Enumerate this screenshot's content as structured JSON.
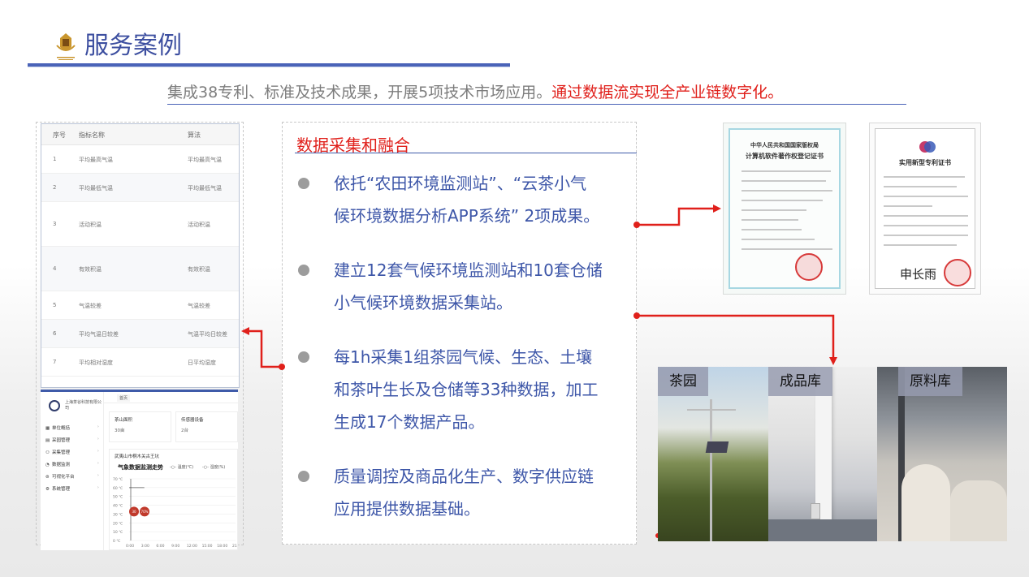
{
  "header": {
    "title": "服务案例",
    "subtitle_plain": "集成38专利、标准及技术成果，开展5项技术市场应用。",
    "subtitle_highlight": "通过数据流实现全产业链数字化。"
  },
  "table": {
    "headers": [
      "序号",
      "指标名称",
      "算法"
    ],
    "rows": [
      {
        "no": "1",
        "name": "平均最高气温",
        "algo": "平均最高气温"
      },
      {
        "no": "2",
        "name": "平均最低气温",
        "algo": "平均最低气温"
      },
      {
        "no": "3",
        "name": "活动积温",
        "algo": "活动积温"
      },
      {
        "no": "4",
        "name": "有效积温",
        "algo": "有效积温"
      },
      {
        "no": "5",
        "name": "气温较差",
        "algo": "气温较差"
      },
      {
        "no": "6",
        "name": "平均气温日较差",
        "algo": "气温平均日较差"
      },
      {
        "no": "7",
        "name": "平均相对湿度",
        "algo": "日平均湿度"
      }
    ]
  },
  "dashboard": {
    "company": "上海茶谷科技有限公司",
    "tab": "首页",
    "menu": [
      "单位概括",
      "采园管理",
      "采集管理",
      "数据监测",
      "可视化平台",
      "系统管理"
    ],
    "cards": [
      {
        "label": "茶山面积",
        "value": "30亩"
      },
      {
        "label": "传感器设备",
        "value": "2台"
      }
    ],
    "chart_name": "武夷山市桐木关古王坑",
    "chart_title": "气象数据监测走势",
    "legend": [
      "温度(℃)",
      "湿度(%)"
    ],
    "markers": [
      "30",
      "70%"
    ],
    "y_ticks": [
      "70 ℃",
      "60 ℃",
      "50 ℃",
      "40 ℃",
      "30 ℃",
      "20 ℃",
      "10 ℃",
      "0 ℃"
    ],
    "x_ticks": [
      "0:00",
      "3:00",
      "6:00",
      "9:00",
      "12:00",
      "15:00",
      "18:00",
      "21"
    ]
  },
  "center": {
    "title": "数据采集和融合",
    "bullets": [
      {
        "lines": [
          "依托“农田环境监测站”、“云茶小气",
          "候环境数据分析APP系统” 2项成果。"
        ]
      },
      {
        "lines": [
          "建立12套气候环境监测站和10套仓储",
          "小气候环境数据采集站。"
        ]
      },
      {
        "lines": [
          "每1h采集1组茶园气候、生态、土壤",
          "和茶叶生长及仓储等33种数据，加工",
          "生成17个数据产品。"
        ]
      },
      {
        "lines": [
          "质量调控及商品化生产、数字供应链",
          "应用提供数据基础。"
        ]
      }
    ]
  },
  "certificates": [
    {
      "title_top": "中华人民共和国国家版权局",
      "title": "计算机软件著作权登记证书"
    },
    {
      "title": "实用新型专利证书",
      "signature": "申长雨"
    }
  ],
  "photos": [
    {
      "label": "茶园"
    },
    {
      "label": "成品库"
    },
    {
      "label": "原料库"
    }
  ],
  "colors": {
    "accent_blue": "#3d56a8",
    "accent_red": "#e0201b",
    "bullet_gray": "#9c9c9c"
  }
}
